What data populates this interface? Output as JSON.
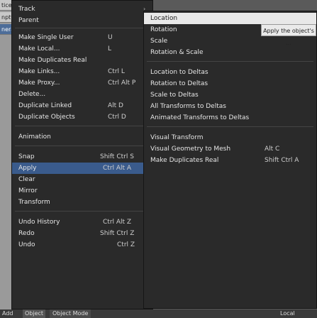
{
  "left_tabs": [
    {
      "label": "tice",
      "style": "normal"
    },
    {
      "label": "npty",
      "style": "normal"
    },
    {
      "label": "nera",
      "style": "sel"
    },
    {
      "label": "Add",
      "style": "dark"
    }
  ],
  "menu": [
    {
      "label": "Track",
      "shortcut": "",
      "arrow": "›"
    },
    {
      "label": "Parent",
      "shortcut": "",
      "arrow": "›"
    },
    {
      "label": "Make Single User",
      "shortcut": "U",
      "arrow": "›"
    },
    {
      "label": "Make Local...",
      "shortcut": "L",
      "arrow": "›"
    },
    {
      "label": "Make Duplicates Real",
      "shortcut": "",
      "arrow": ""
    },
    {
      "label": "Make Links...",
      "shortcut": "Ctrl L",
      "arrow": "›"
    },
    {
      "label": "Make Proxy...",
      "shortcut": "Ctrl Alt P",
      "arrow": ""
    },
    {
      "label": "Delete...",
      "shortcut": "",
      "arrow": ""
    },
    {
      "label": "Duplicate Linked",
      "shortcut": "Alt D",
      "arrow": ""
    },
    {
      "label": "Duplicate Objects",
      "shortcut": "Ctrl D",
      "arrow": ""
    },
    {
      "label": "Animation",
      "shortcut": "",
      "arrow": "›"
    },
    {
      "label": "Snap",
      "shortcut": "Shift Ctrl S",
      "arrow": "›"
    },
    {
      "label": "Apply",
      "shortcut": "Ctrl Alt A",
      "arrow": "›"
    },
    {
      "label": "Clear",
      "shortcut": "",
      "arrow": "›"
    },
    {
      "label": "Mirror",
      "shortcut": "",
      "arrow": "›"
    },
    {
      "label": "Transform",
      "shortcut": "",
      "arrow": "›"
    },
    {
      "label": "Undo History",
      "shortcut": "Ctrl Alt Z",
      "arrow": ""
    },
    {
      "label": "Redo",
      "shortcut": "Shift Ctrl Z",
      "arrow": ""
    },
    {
      "label": "Undo",
      "shortcut": "Ctrl Z",
      "arrow": ""
    }
  ],
  "submenu": [
    {
      "label": "Location"
    },
    {
      "label": "Rotation"
    },
    {
      "label": "Scale"
    },
    {
      "label": "Rotation & Scale"
    },
    {
      "label": "Location to Deltas"
    },
    {
      "label": "Rotation to Deltas"
    },
    {
      "label": "Scale to Deltas"
    },
    {
      "label": "All Transforms to Deltas"
    },
    {
      "label": "Animated Transforms to Deltas"
    },
    {
      "label": "Visual Transform"
    },
    {
      "label": "Visual Geometry to Mesh"
    },
    {
      "label": "Make Duplicates Real"
    }
  ],
  "submenu_shortcuts": {
    "visual_geometry": "Alt C",
    "make_dup": "Shift Ctrl A"
  },
  "tooltip": "Apply the object's ...",
  "bottom": {
    "add": "Add",
    "object": "Object",
    "mode": "Object Mode",
    "local": "Local"
  }
}
